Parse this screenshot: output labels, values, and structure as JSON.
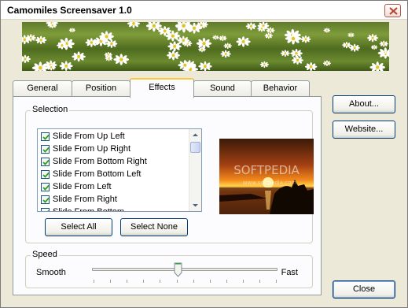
{
  "window": {
    "title": "Camomiles Screensaver 1.0"
  },
  "tabs": [
    {
      "label": "General"
    },
    {
      "label": "Position"
    },
    {
      "label": "Effects"
    },
    {
      "label": "Sound"
    },
    {
      "label": "Behavior"
    }
  ],
  "selection": {
    "label": "Selection",
    "items": [
      {
        "label": "Slide From Up Left",
        "checked": true
      },
      {
        "label": "Slide From Up Right",
        "checked": true
      },
      {
        "label": "Slide From Bottom Right",
        "checked": true
      },
      {
        "label": "Slide From Bottom Left",
        "checked": true
      },
      {
        "label": "Slide From Left",
        "checked": true
      },
      {
        "label": "Slide From Right",
        "checked": true
      },
      {
        "label": "Slide From Bottom",
        "checked": true
      }
    ],
    "select_all_label": "Select All",
    "select_none_label": "Select None"
  },
  "preview": {
    "watermark": "SOFTPEDIA",
    "watermark_url": "www.softpedia.com"
  },
  "speed": {
    "label": "Speed",
    "min_label": "Smooth",
    "max_label": "Fast",
    "value_fraction": 0.46
  },
  "side_buttons": {
    "about_label": "About...",
    "website_label": "Website...",
    "close_label": "Close"
  }
}
